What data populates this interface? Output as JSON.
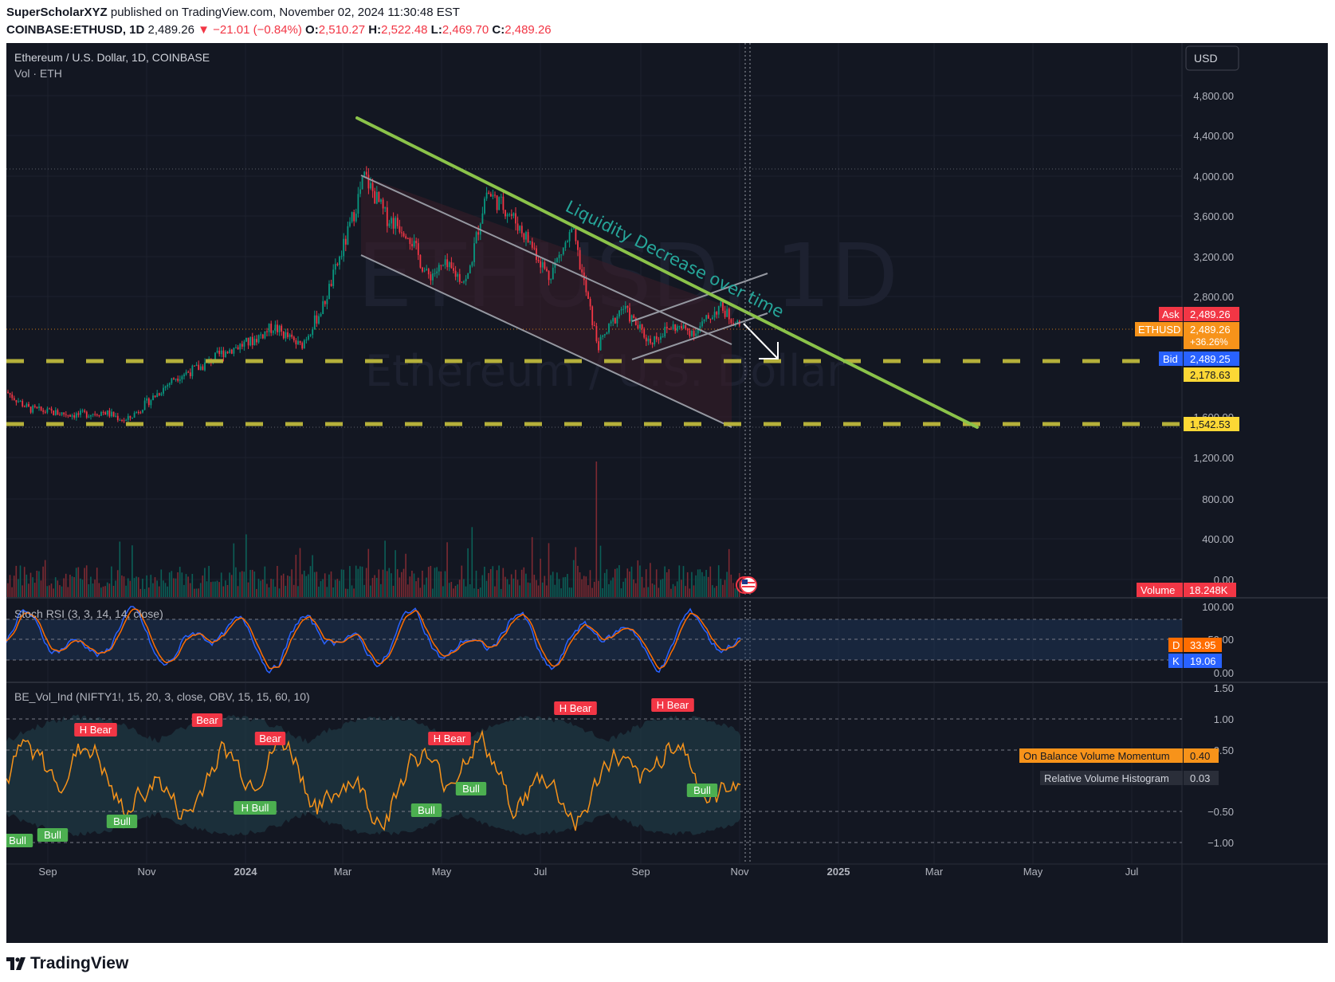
{
  "header": {
    "author": "SuperScholarXYZ",
    "published": "published on TradingView.com, November 02, 2024 11:30:48 EST",
    "symbol_line": "COINBASE:ETHUSD, 1D",
    "last": "2,489.26",
    "change": "−21.01 (−0.84%)",
    "o_label": "O:",
    "o": "2,510.27",
    "h_label": "H:",
    "h": "2,522.48",
    "l_label": "L:",
    "l": "2,469.70",
    "c_label": "C:",
    "c": "2,489.26"
  },
  "legend": {
    "title": "Ethereum / U.S. Dollar, 1D, COINBASE",
    "vol": "Vol · ETH",
    "stoch": "Stoch RSI (3, 3, 14, 14, close)",
    "bevol": "BE_Vol_Ind (NIFTY1!, 15, 20, 3, close, OBV, 15, 15, 60, 10)"
  },
  "watermark": {
    "symbol": "ETHUSD, 1D",
    "name": "Ethereum / U.S. Dollar"
  },
  "currency": "USD",
  "annotation": "Liquidity Decrease over time",
  "price_tags": {
    "ask_label": "Ask",
    "ask": "2,489.26",
    "sym_label": "ETHUSD",
    "sym": "2,489.26",
    "sym_pct": "+36.26%",
    "bid_label": "Bid",
    "bid": "2,489.25",
    "level1": "2,178.63",
    "level2": "1,542.53",
    "vol_label": "Volume",
    "vol": "18.248K",
    "d_label": "D",
    "d": "33.95",
    "k_label": "K",
    "k": "19.06",
    "obv_label": "On Balance Volume Momentum",
    "obv": "0.40",
    "rvh_label": "Relative Volume Histogram",
    "rvh": "0.03"
  },
  "price_axis_ticks": [
    "4,800.00",
    "4,400.00",
    "4,000.00",
    "3,600.00",
    "3,200.00",
    "2,800.00",
    "1,600.00",
    "1,200.00",
    "800.00",
    "400.00",
    "0.00"
  ],
  "stoch_axis_ticks": [
    "100.00",
    "50.00",
    "0.00"
  ],
  "bevol_axis_ticks": [
    "1.50",
    "1.00",
    "0.50",
    "−0.50",
    "−1.00"
  ],
  "time_axis_ticks": [
    "Sep",
    "Nov",
    "2024",
    "Mar",
    "May",
    "Jul",
    "Sep",
    "Nov",
    "2025",
    "Mar",
    "May",
    "Jul"
  ],
  "signals": [
    {
      "text": "H Bear",
      "type": "bear"
    },
    {
      "text": "Bear",
      "type": "bear"
    },
    {
      "text": "Bear",
      "type": "bear"
    },
    {
      "text": "H Bear",
      "type": "bear"
    },
    {
      "text": "H Bear",
      "type": "bear"
    },
    {
      "text": "H Bear",
      "type": "bear"
    },
    {
      "text": "Bull",
      "type": "bull"
    },
    {
      "text": "Bull",
      "type": "bull"
    },
    {
      "text": "Bull",
      "type": "bull"
    },
    {
      "text": "H Bull",
      "type": "bull"
    },
    {
      "text": "Bull",
      "type": "bull"
    },
    {
      "text": "Bull",
      "type": "bull"
    },
    {
      "text": "Bull",
      "type": "bull"
    }
  ],
  "footer": {
    "brand": "TradingView"
  },
  "colors": {
    "background": "#131722",
    "up": "#089981",
    "down": "#f23645",
    "trend": "#8bc34a",
    "level": "#b5b03a",
    "channel": "#9598a1"
  },
  "chart_data": {
    "type": "candlestick",
    "title": "Ethereum / U.S. Dollar, 1D, COINBASE",
    "x": [
      "2023-08-01",
      "2023-08-15",
      "2023-09-01",
      "2023-09-15",
      "2023-10-01",
      "2023-10-15",
      "2023-11-01",
      "2023-11-15",
      "2023-12-01",
      "2023-12-15",
      "2024-01-01",
      "2024-01-15",
      "2024-02-01",
      "2024-02-15",
      "2024-03-01",
      "2024-03-12",
      "2024-03-25",
      "2024-04-08",
      "2024-04-20",
      "2024-05-01",
      "2024-05-15",
      "2024-05-27",
      "2024-06-10",
      "2024-06-25",
      "2024-07-05",
      "2024-07-20",
      "2024-08-05",
      "2024-08-20",
      "2024-09-06",
      "2024-09-20",
      "2024-10-05",
      "2024-10-20",
      "2024-11-02"
    ],
    "close": [
      1850,
      1680,
      1640,
      1620,
      1650,
      1560,
      1800,
      2000,
      2100,
      2250,
      2350,
      2500,
      2300,
      2700,
      3400,
      4000,
      3600,
      3450,
      3000,
      3100,
      2950,
      3850,
      3650,
      3300,
      3000,
      3450,
      2300,
      2700,
      2350,
      2500,
      2450,
      2700,
      2489.26
    ],
    "ylim": [
      0,
      5000
    ],
    "levels": [
      2178.63,
      1542.53
    ],
    "indicators": {
      "stoch_rsi": {
        "D": 33.95,
        "K": 19.06
      },
      "obv_momentum": 0.4,
      "relative_volume_histogram": 0.03,
      "volume": "18.248K"
    }
  }
}
